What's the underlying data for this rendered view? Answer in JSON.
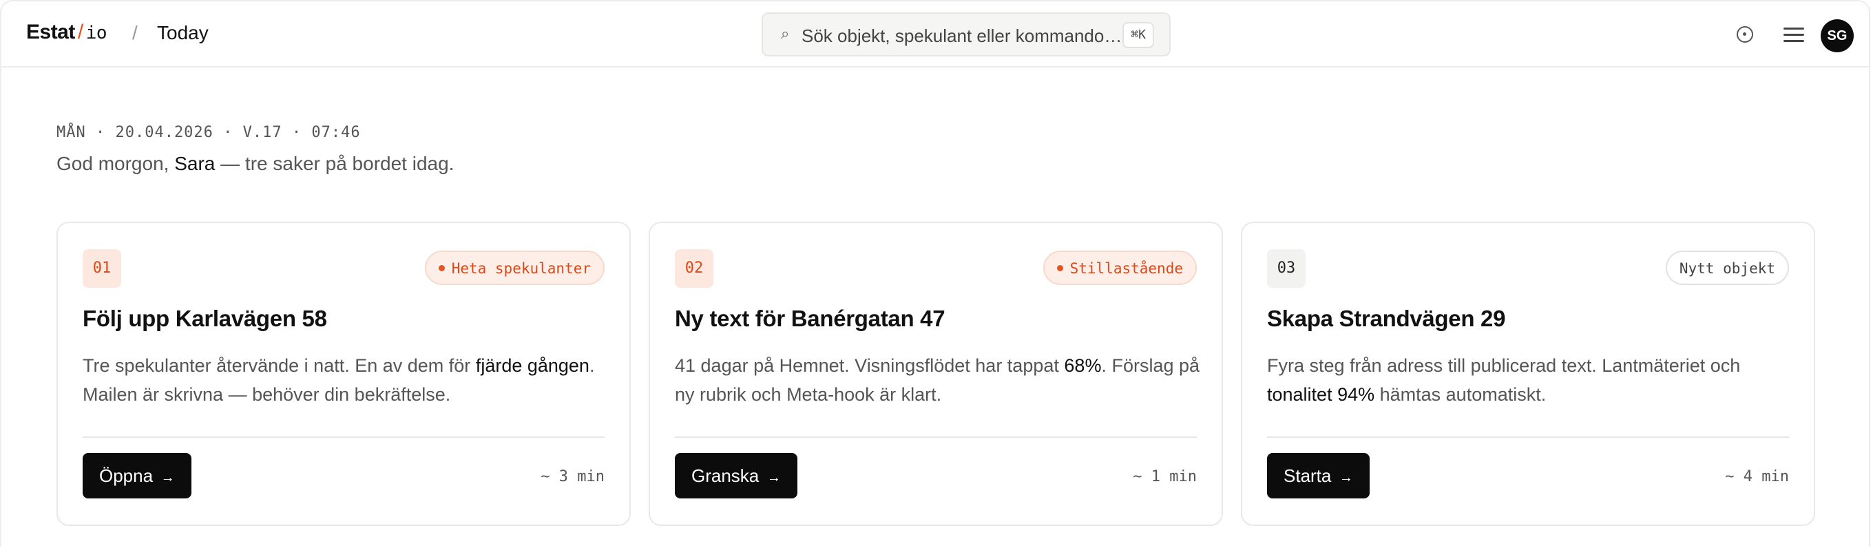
{
  "header": {
    "logo_main": "Estat",
    "logo_slash": "/",
    "logo_sub": "io",
    "breadcrumb_sep": "/",
    "breadcrumb": "Today",
    "search_placeholder": "Sök objekt, spekulant eller kommando…",
    "search_shortcut": "⌘K",
    "avatar_initials": "SG"
  },
  "intro": {
    "date_line": "MÅN · 20.04.2026 · V.17 · 07:46",
    "greeting_prefix": "God morgon,",
    "greeting_name": "Sara",
    "greeting_suffix": "— tre saker på bordet idag."
  },
  "cards": [
    {
      "number": "01",
      "tag": "Heta spekulanter",
      "title": "Följ upp Karlavägen 58",
      "desc_1": "Tre spekulanter återvände i natt. En av dem för",
      "desc_hl": "fjärde gången",
      "desc_2": ". Mailen är skrivna — behöver din bekräftelse.",
      "button": "Öppna",
      "time": "~ 3 min"
    },
    {
      "number": "02",
      "tag": "Stillastående",
      "title": "Ny text för Banérgatan 47",
      "desc_1": "41 dagar på Hemnet. Visningsflödet har tappat",
      "desc_hl": "68%",
      "desc_2": ". Förslag på ny rubrik och Meta-hook är klart.",
      "button": "Granska",
      "time": "~ 1 min"
    },
    {
      "number": "03",
      "tag": "Nytt objekt",
      "title": "Skapa Strandvägen 29",
      "desc_1": "Fyra steg från adress till publicerad text. Lantmäteriet och",
      "desc_hl": "tonalitet 94%",
      "desc_2": "hämtas automatiskt.",
      "button": "Starta",
      "time": "~ 4 min"
    }
  ],
  "colors": {
    "accent": "#e8541f",
    "button_bg": "#0c0c0c",
    "tag_hot_bg": "#fdeee8"
  }
}
